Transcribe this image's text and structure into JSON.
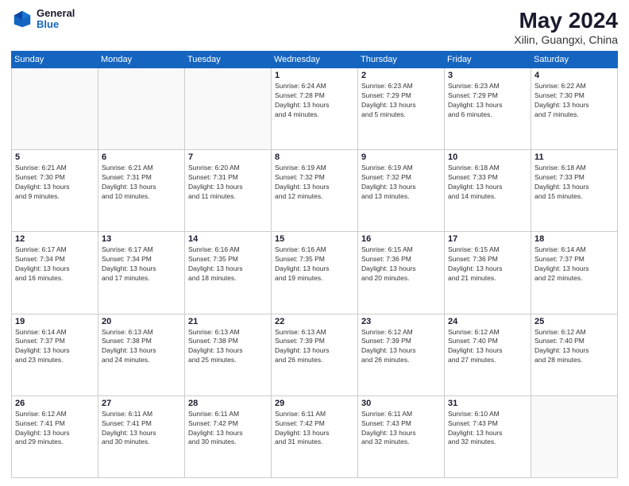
{
  "header": {
    "logo_general": "General",
    "logo_blue": "Blue",
    "title": "May 2024",
    "location": "Xilin, Guangxi, China"
  },
  "weekdays": [
    "Sunday",
    "Monday",
    "Tuesday",
    "Wednesday",
    "Thursday",
    "Friday",
    "Saturday"
  ],
  "weeks": [
    [
      {
        "day": "",
        "text": ""
      },
      {
        "day": "",
        "text": ""
      },
      {
        "day": "",
        "text": ""
      },
      {
        "day": "1",
        "text": "Sunrise: 6:24 AM\nSunset: 7:28 PM\nDaylight: 13 hours\nand 4 minutes."
      },
      {
        "day": "2",
        "text": "Sunrise: 6:23 AM\nSunset: 7:29 PM\nDaylight: 13 hours\nand 5 minutes."
      },
      {
        "day": "3",
        "text": "Sunrise: 6:23 AM\nSunset: 7:29 PM\nDaylight: 13 hours\nand 6 minutes."
      },
      {
        "day": "4",
        "text": "Sunrise: 6:22 AM\nSunset: 7:30 PM\nDaylight: 13 hours\nand 7 minutes."
      }
    ],
    [
      {
        "day": "5",
        "text": "Sunrise: 6:21 AM\nSunset: 7:30 PM\nDaylight: 13 hours\nand 9 minutes."
      },
      {
        "day": "6",
        "text": "Sunrise: 6:21 AM\nSunset: 7:31 PM\nDaylight: 13 hours\nand 10 minutes."
      },
      {
        "day": "7",
        "text": "Sunrise: 6:20 AM\nSunset: 7:31 PM\nDaylight: 13 hours\nand 11 minutes."
      },
      {
        "day": "8",
        "text": "Sunrise: 6:19 AM\nSunset: 7:32 PM\nDaylight: 13 hours\nand 12 minutes."
      },
      {
        "day": "9",
        "text": "Sunrise: 6:19 AM\nSunset: 7:32 PM\nDaylight: 13 hours\nand 13 minutes."
      },
      {
        "day": "10",
        "text": "Sunrise: 6:18 AM\nSunset: 7:33 PM\nDaylight: 13 hours\nand 14 minutes."
      },
      {
        "day": "11",
        "text": "Sunrise: 6:18 AM\nSunset: 7:33 PM\nDaylight: 13 hours\nand 15 minutes."
      }
    ],
    [
      {
        "day": "12",
        "text": "Sunrise: 6:17 AM\nSunset: 7:34 PM\nDaylight: 13 hours\nand 16 minutes."
      },
      {
        "day": "13",
        "text": "Sunrise: 6:17 AM\nSunset: 7:34 PM\nDaylight: 13 hours\nand 17 minutes."
      },
      {
        "day": "14",
        "text": "Sunrise: 6:16 AM\nSunset: 7:35 PM\nDaylight: 13 hours\nand 18 minutes."
      },
      {
        "day": "15",
        "text": "Sunrise: 6:16 AM\nSunset: 7:35 PM\nDaylight: 13 hours\nand 19 minutes."
      },
      {
        "day": "16",
        "text": "Sunrise: 6:15 AM\nSunset: 7:36 PM\nDaylight: 13 hours\nand 20 minutes."
      },
      {
        "day": "17",
        "text": "Sunrise: 6:15 AM\nSunset: 7:36 PM\nDaylight: 13 hours\nand 21 minutes."
      },
      {
        "day": "18",
        "text": "Sunrise: 6:14 AM\nSunset: 7:37 PM\nDaylight: 13 hours\nand 22 minutes."
      }
    ],
    [
      {
        "day": "19",
        "text": "Sunrise: 6:14 AM\nSunset: 7:37 PM\nDaylight: 13 hours\nand 23 minutes."
      },
      {
        "day": "20",
        "text": "Sunrise: 6:13 AM\nSunset: 7:38 PM\nDaylight: 13 hours\nand 24 minutes."
      },
      {
        "day": "21",
        "text": "Sunrise: 6:13 AM\nSunset: 7:38 PM\nDaylight: 13 hours\nand 25 minutes."
      },
      {
        "day": "22",
        "text": "Sunrise: 6:13 AM\nSunset: 7:39 PM\nDaylight: 13 hours\nand 26 minutes."
      },
      {
        "day": "23",
        "text": "Sunrise: 6:12 AM\nSunset: 7:39 PM\nDaylight: 13 hours\nand 26 minutes."
      },
      {
        "day": "24",
        "text": "Sunrise: 6:12 AM\nSunset: 7:40 PM\nDaylight: 13 hours\nand 27 minutes."
      },
      {
        "day": "25",
        "text": "Sunrise: 6:12 AM\nSunset: 7:40 PM\nDaylight: 13 hours\nand 28 minutes."
      }
    ],
    [
      {
        "day": "26",
        "text": "Sunrise: 6:12 AM\nSunset: 7:41 PM\nDaylight: 13 hours\nand 29 minutes."
      },
      {
        "day": "27",
        "text": "Sunrise: 6:11 AM\nSunset: 7:41 PM\nDaylight: 13 hours\nand 30 minutes."
      },
      {
        "day": "28",
        "text": "Sunrise: 6:11 AM\nSunset: 7:42 PM\nDaylight: 13 hours\nand 30 minutes."
      },
      {
        "day": "29",
        "text": "Sunrise: 6:11 AM\nSunset: 7:42 PM\nDaylight: 13 hours\nand 31 minutes."
      },
      {
        "day": "30",
        "text": "Sunrise: 6:11 AM\nSunset: 7:43 PM\nDaylight: 13 hours\nand 32 minutes."
      },
      {
        "day": "31",
        "text": "Sunrise: 6:10 AM\nSunset: 7:43 PM\nDaylight: 13 hours\nand 32 minutes."
      },
      {
        "day": "",
        "text": ""
      }
    ]
  ]
}
